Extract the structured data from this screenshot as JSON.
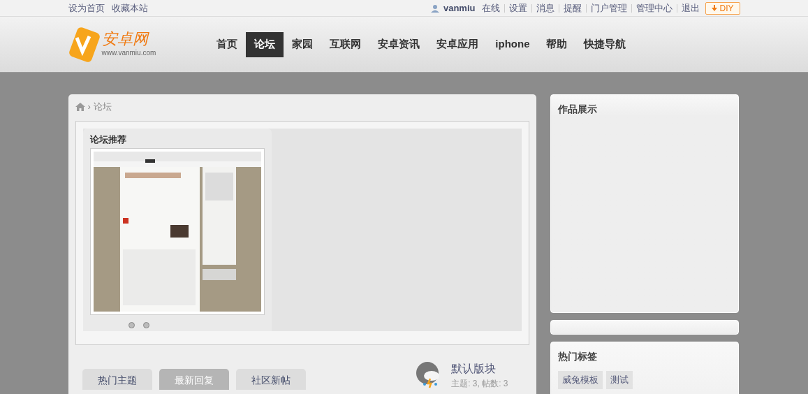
{
  "topbar": {
    "left_links": [
      "设为首页",
      "收藏本站"
    ],
    "username": "vanmiu",
    "right_links": [
      "在线",
      "设置",
      "消息",
      "提醒",
      "门户管理",
      "管理中心",
      "退出"
    ],
    "diy_button": "DIY"
  },
  "logo": {
    "name": "安卓网",
    "url": "www.vanmiu.com"
  },
  "nav": [
    {
      "label": "首页",
      "selected": false
    },
    {
      "label": "论坛",
      "selected": true
    },
    {
      "label": "家园",
      "selected": false
    },
    {
      "label": "互联网",
      "selected": false
    },
    {
      "label": "安卓资讯",
      "selected": false
    },
    {
      "label": "安卓应用",
      "selected": false
    },
    {
      "label": "iphone",
      "selected": false
    },
    {
      "label": "帮助",
      "selected": false
    },
    {
      "label": "快捷导航",
      "selected": false
    }
  ],
  "breadcrumb": {
    "separator": "›",
    "current": "论坛"
  },
  "recommend": {
    "title": "论坛推荐",
    "dots": [
      {
        "selected": false
      },
      {
        "selected": false
      }
    ]
  },
  "tabs": [
    {
      "label": "热门主题",
      "selected": false
    },
    {
      "label": "最新回复",
      "selected": true
    },
    {
      "label": "社区新帖",
      "selected": false
    }
  ],
  "forum": {
    "name": "默认版块",
    "stats": "主题: 3, 帖数: 3"
  },
  "sidebar": {
    "showcase_title": "作品展示",
    "tags_title": "热门标签",
    "tags": [
      "威兔模板",
      "测试"
    ]
  }
}
